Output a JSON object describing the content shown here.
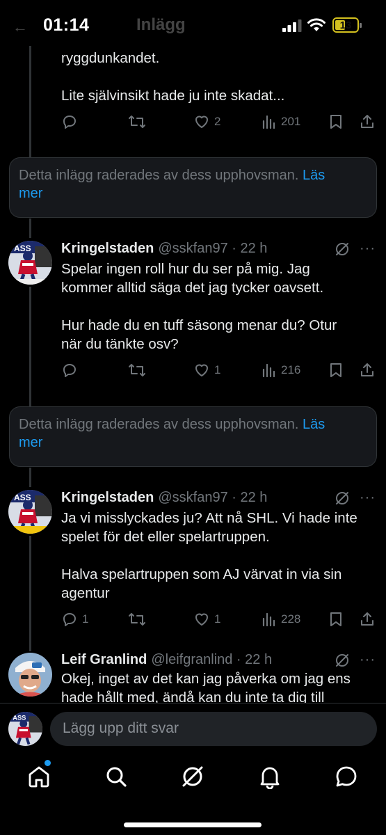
{
  "status_bar": {
    "time": "01:14",
    "ghost_title": "Inlägg",
    "battery": "13"
  },
  "tweets": [
    {
      "text_lines": [
        "ryggdunkandet.",
        "",
        "Lite självinsikt hade ju inte skadat..."
      ],
      "reply_count": "",
      "like_count": "2",
      "view_count": "201"
    },
    {
      "name": "Kringelstaden",
      "handle": "@sskfan97 · 22 h",
      "text_lines": [
        "Spelar ingen roll hur du ser på mig. Jag",
        "kommer alltid säga det jag tycker oavsett.",
        "",
        "Hur hade du en tuff säsong menar du? Otur",
        "när du tänkte osv?"
      ],
      "reply_count": "",
      "like_count": "1",
      "view_count": "216"
    },
    {
      "name": "Kringelstaden",
      "handle": "@sskfan97 · 22 h",
      "text_lines": [
        "Ja vi misslyckades ju? Att nå SHL. Vi hade inte",
        "spelet för det eller spelartruppen.",
        "",
        "Halva spelartruppen som AJ värvat in via sin",
        "agentur"
      ],
      "reply_count": "1",
      "like_count": "1",
      "view_count": "228"
    },
    {
      "name": "Leif Granlind",
      "handle": "@leifgranlind · 22 h",
      "text_lines": [
        "Okej, inget av det kan jag påverka om jag ens",
        "hade hållt med, ändå kan du inte ta dig till"
      ]
    }
  ],
  "deleted_notice": {
    "text": "Detta inlägg raderades av dess upphovsman.",
    "link": "Läs mer",
    "link_part1": "Läs",
    "link_part2": "mer"
  },
  "reply_bar": {
    "placeholder": "Lägg upp ditt svar"
  },
  "nav": {
    "items": [
      "home-icon",
      "search-icon",
      "grok-icon",
      "notifications-icon",
      "messages-icon"
    ],
    "accent": "#1d9bf0"
  }
}
